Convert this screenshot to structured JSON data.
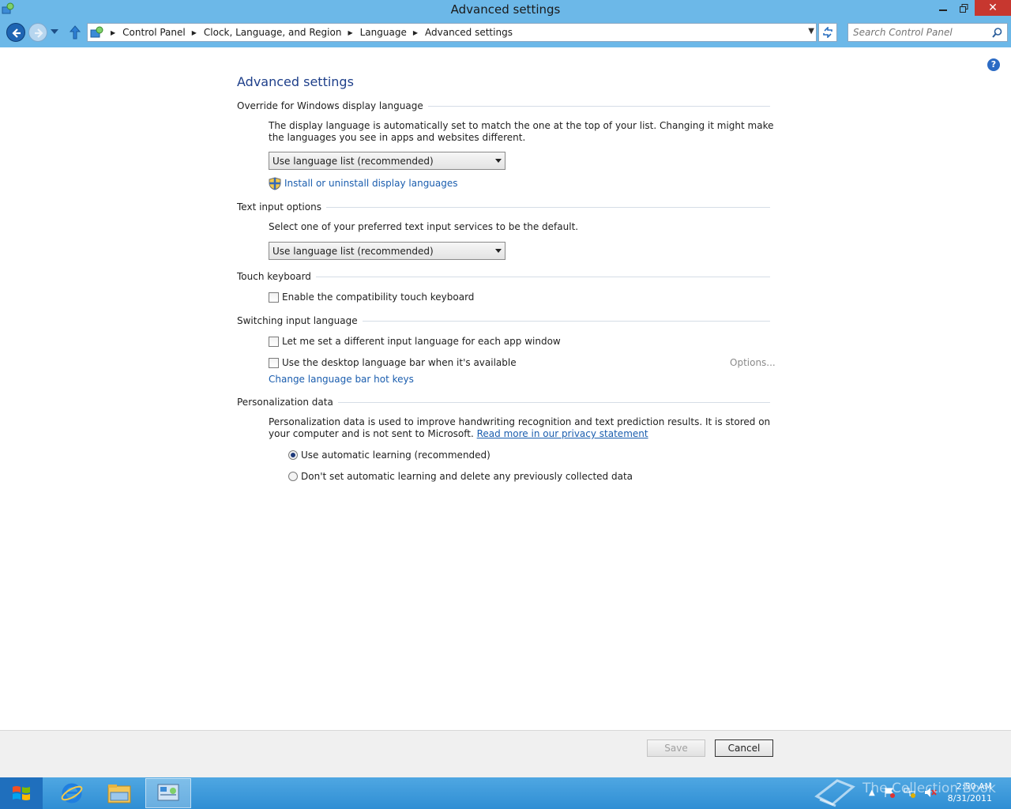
{
  "window": {
    "title": "Advanced settings"
  },
  "nav": {
    "breadcrumbs": [
      "Control Panel",
      "Clock, Language, and Region",
      "Language",
      "Advanced settings"
    ],
    "search_placeholder": "Search Control Panel"
  },
  "page": {
    "title": "Advanced settings",
    "sections": {
      "display_language": {
        "heading": "Override for Windows display language",
        "description": "The display language is automatically set to match the one at the top of your list. Changing it might make the languages you see in apps and websites different.",
        "select_value": "Use language list (recommended)",
        "link": "Install or uninstall display languages"
      },
      "text_input": {
        "heading": "Text input options",
        "description": "Select one of your preferred text input services to be the default.",
        "select_value": "Use language list (recommended)"
      },
      "touch_keyboard": {
        "heading": "Touch keyboard",
        "checkbox_label": "Enable the compatibility touch keyboard",
        "checked": false
      },
      "switching": {
        "heading": "Switching input language",
        "checkbox1_label": "Let me set a different input language for each app window",
        "checkbox2_label": "Use the desktop language bar when it's available",
        "options_link": "Options...",
        "hotkeys_link": "Change language bar hot keys"
      },
      "personalization": {
        "heading": "Personalization data",
        "description": "Personalization data is used to improve handwriting recognition and text prediction results. It is stored on your computer and is not sent to Microsoft.",
        "privacy_link": "Read more in our privacy statement",
        "radio1_label": "Use automatic learning (recommended)",
        "radio2_label": "Don't set automatic learning and delete any previously collected data",
        "selected": "radio1"
      }
    }
  },
  "footer": {
    "save_label": "Save",
    "cancel_label": "Cancel"
  },
  "taskbar": {
    "time": "2:50 AM",
    "date": "8/31/2011",
    "watermark": "The Collection Book"
  },
  "colors": {
    "chrome": "#6cb8e8",
    "link": "#1a5dae",
    "title": "#1e3f8a",
    "close": "#c7372f"
  }
}
